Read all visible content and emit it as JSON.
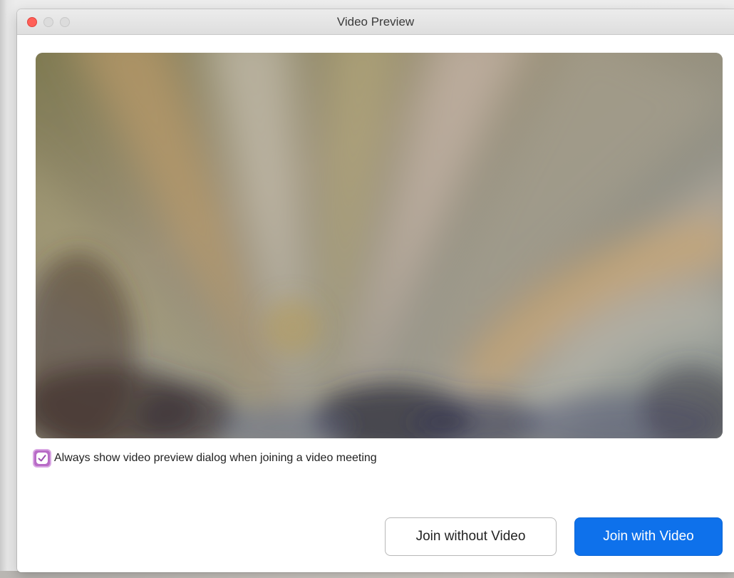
{
  "window": {
    "title": "Video Preview"
  },
  "preview": {
    "always_show_checked": true,
    "always_show_label": "Always show video preview dialog when joining a video meeting"
  },
  "actions": {
    "join_without_video_label": "Join without Video",
    "join_with_video_label": "Join with Video"
  },
  "colors": {
    "accent": "#0e71eb",
    "checkbox": "#b86bc7",
    "close_button": "#ff5f57"
  }
}
